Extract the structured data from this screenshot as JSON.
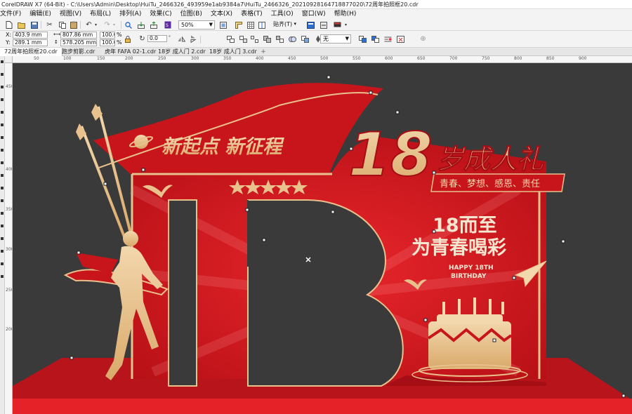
{
  "window": {
    "title": "CorelDRAW X7 (64-Bit) - C:\\Users\\Admin\\Desktop\\HuiTu_2466326_493959e1ab9384a7\\HuiTu_2466326_20210928164718877020\\72周年拍照框20.cdr"
  },
  "menu": [
    "文件(F)",
    "编辑(E)",
    "视图(V)",
    "布局(L)",
    "排列(A)",
    "效果(C)",
    "位图(B)",
    "文本(X)",
    "表格(T)",
    "工具(O)",
    "窗口(W)",
    "帮助(H)"
  ],
  "toolbar": {
    "zoom": "50%",
    "snap": "贴齐(T)"
  },
  "property_bar": {
    "x_label": "X:",
    "x_value": "403.9 mm",
    "y_label": "Y:",
    "y_value": "289.1 mm",
    "w_value": "807.86 mm",
    "h_value": "578.205 mm",
    "scale_w": "100.0",
    "scale_h": "100.0",
    "percent": "%",
    "angle": "0.0",
    "outline": "无"
  },
  "tabs": [
    "72周年拍照框20.cdr",
    "跑步剪影.cdr",
    "虎年 FAFA 02-1.cdr",
    "18岁 成人门 2.cdr",
    "18岁 成人门 3.cdr"
  ],
  "ruler": {
    "h_labels": [
      "50",
      "100",
      "150",
      "200",
      "250",
      "300",
      "350",
      "400",
      "450",
      "500",
      "550",
      "600",
      "650",
      "700",
      "750",
      "800",
      "850",
      "900"
    ],
    "v_labels": [
      "450",
      "400",
      "350",
      "300",
      "250",
      "200"
    ]
  },
  "design": {
    "slogan": "新起点 新征程",
    "big_number": "18",
    "ceremony": "岁成人礼",
    "keywords": "青春、梦想、感恩、责任",
    "line1": "18而至",
    "line2": "为青春喝彩",
    "happy_line1": "HAPPY 18TH",
    "happy_line2": "BIRTHDAY"
  },
  "colors": {
    "red": "#d0141b",
    "dark_red": "#a50e14",
    "gold": "#e8c18d",
    "background": "#3a3a3a"
  }
}
